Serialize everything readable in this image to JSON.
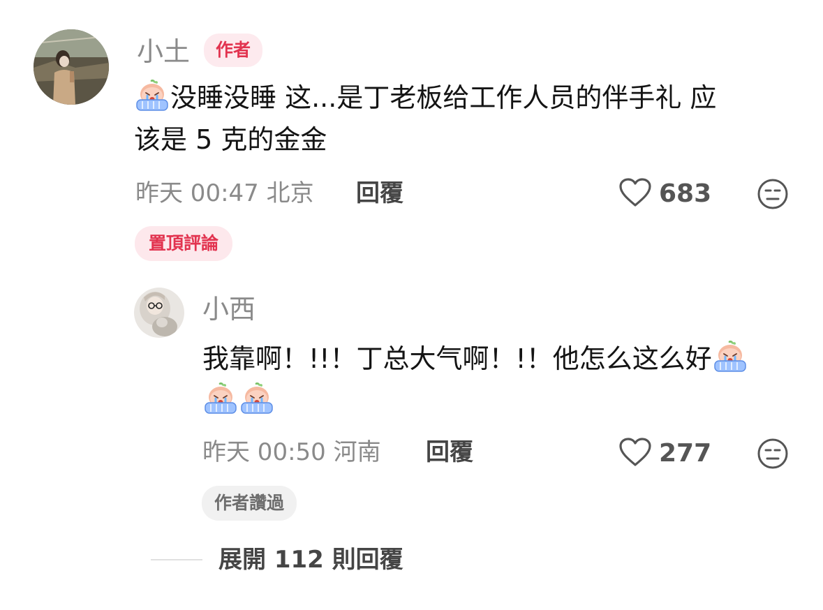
{
  "comments": [
    {
      "username": "小土",
      "badge": "作者",
      "text_line1": "没睡没睡 这...是丁老板给工作人员的伴手礼  应",
      "text_line2": "该是 5 克的金金",
      "time": "昨天 00:47",
      "location": "北京",
      "reply_label": "回覆",
      "likes": "683",
      "pinned_label": "置頂評論"
    },
    {
      "username": "小西",
      "text_line1": "我靠啊！!!！丁总大气啊！!！他怎么这么好",
      "time": "昨天 00:50",
      "location": "河南",
      "reply_label": "回覆",
      "likes": "277",
      "liked_by_author_label": "作者讚過"
    }
  ],
  "expand_replies": "展開 112 則回覆",
  "icons": {
    "like": "heart-outline-icon",
    "dislike": "neutral-face-icon",
    "emoji": "crying-peach-emoji"
  },
  "colors": {
    "badge_red": "#e2334f",
    "badge_bg": "#fdeaee",
    "meta_gray": "#8a8a8a"
  }
}
